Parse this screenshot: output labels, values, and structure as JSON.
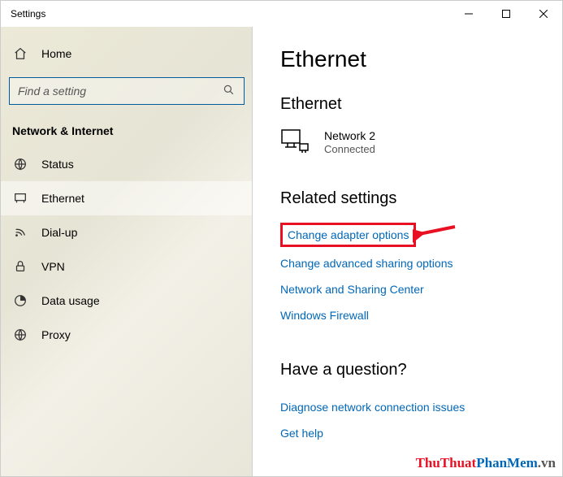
{
  "window": {
    "title": "Settings"
  },
  "sidebar": {
    "home": "Home",
    "search_placeholder": "Find a setting",
    "section": "Network & Internet",
    "items": [
      {
        "label": "Status"
      },
      {
        "label": "Ethernet"
      },
      {
        "label": "Dial-up"
      },
      {
        "label": "VPN"
      },
      {
        "label": "Data usage"
      },
      {
        "label": "Proxy"
      }
    ]
  },
  "main": {
    "title": "Ethernet",
    "connection": {
      "heading": "Ethernet",
      "name": "Network 2",
      "status": "Connected"
    },
    "related": {
      "heading": "Related settings",
      "links": [
        "Change adapter options",
        "Change advanced sharing options",
        "Network and Sharing Center",
        "Windows Firewall"
      ]
    },
    "question": {
      "heading": "Have a question?",
      "links": [
        "Diagnose network connection issues",
        "Get help"
      ]
    }
  },
  "watermark": {
    "a": "ThuThuat",
    "b": "PhanMem",
    "c": ".vn"
  },
  "annotation": {
    "highlight_color": "#e81123"
  }
}
